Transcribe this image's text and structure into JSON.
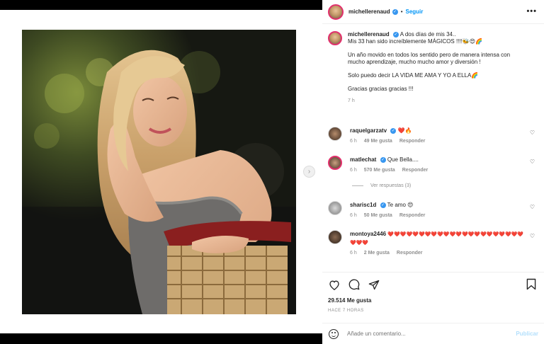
{
  "post": {
    "username": "michellerenaud",
    "follow_label": "Seguir",
    "dot": "•",
    "more_label": "•••"
  },
  "caption": {
    "username": "michellerenaud",
    "line1": "A dos días de mis 34..",
    "line2": "Mis 33 han sido increíblemente MÁGICOS !!!!🐝😍🌈",
    "para2": "Un año movido en todos los sentido pero de manera intensa con mucho aprendizaje, mucho mucho amor y diversión !",
    "para3": "Solo puedo decir LA VIDA ME AMA Y YO A ELLA🌈",
    "para4": "Gracias gracias gracias !!!",
    "time": "7 h"
  },
  "comments": [
    {
      "username": "raquelgarzatv",
      "verified": true,
      "text": "❤️🔥",
      "time": "6 h",
      "likes": "49 Me gusta",
      "reply": "Responder"
    },
    {
      "username": "matlechat",
      "verified": true,
      "text": "Que Bella....",
      "time": "6 h",
      "likes": "570 Me gusta",
      "reply": "Responder"
    },
    {
      "username": "sharisc1d",
      "verified": true,
      "text": "Te amo 😍",
      "time": "6 h",
      "likes": "50 Me gusta",
      "reply": "Responder"
    },
    {
      "username": "montoya2446",
      "verified": false,
      "text": "❤️❤️❤️❤️❤️❤️❤️❤️❤️❤️❤️❤️❤️❤️❤️❤️❤️❤️❤️❤️❤️❤️❤️❤️❤️",
      "time": "6 h",
      "likes": "2 Me gusta",
      "reply": "Responder"
    }
  ],
  "view_replies": "Ver respuestas (3)",
  "actions": {
    "likes": "29.514 Me gusta",
    "ago": "HACE 7 HORAS"
  },
  "add_comment": {
    "placeholder": "Añade un comentario...",
    "publish": "Publicar"
  },
  "icons": {
    "like": "heart-icon",
    "comment": "comment-icon",
    "share": "share-icon",
    "save": "bookmark-icon",
    "emoji": "emoji-icon",
    "next": "chevron-right-icon",
    "more": "more-options-icon"
  }
}
